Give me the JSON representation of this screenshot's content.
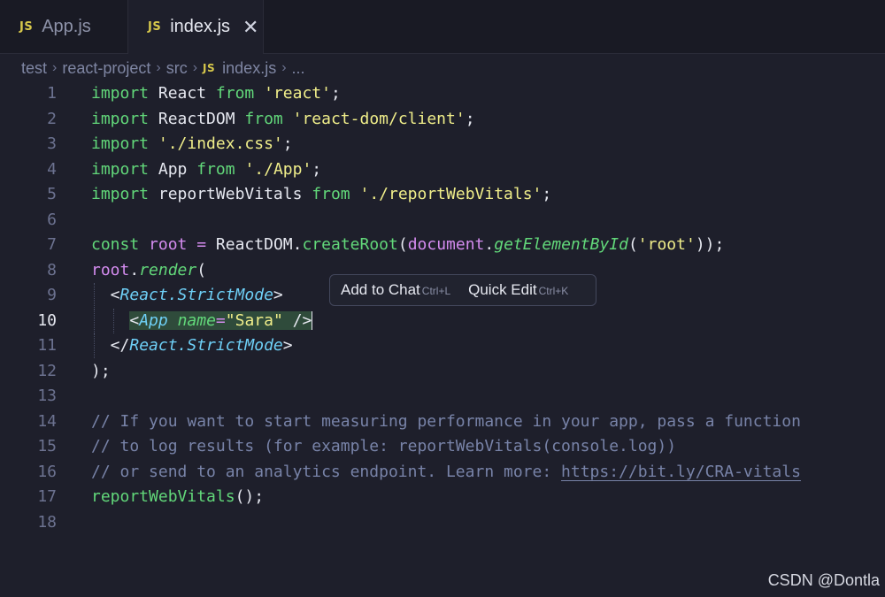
{
  "tabs": [
    {
      "badge": "JS",
      "label": "App.js",
      "active": false
    },
    {
      "badge": "JS",
      "label": "index.js",
      "active": true,
      "close_icon": "close-icon"
    }
  ],
  "breadcrumb": {
    "items": [
      "test",
      "react-project",
      "src"
    ],
    "file_badge": "JS",
    "file": "index.js",
    "more": "..."
  },
  "editor": {
    "active_line": 10,
    "line_numbers": [
      "1",
      "2",
      "3",
      "4",
      "5",
      "6",
      "7",
      "8",
      "9",
      "10",
      "11",
      "12",
      "13",
      "14",
      "15",
      "16",
      "17",
      "18"
    ],
    "tokens": {
      "import": "import",
      "from": "from",
      "react_id": "React",
      "react_str": "'react'",
      "reactdom_id": "ReactDOM",
      "reactdom_str": "'react-dom/client'",
      "css_str": "'./index.css'",
      "app_id": "App",
      "app_str": "'./App'",
      "rwv_id": "reportWebVitals",
      "rwv_str": "'./reportWebVitals'",
      "const": "const",
      "root": "root",
      "eq": "=",
      "createRoot": "createRoot",
      "document": "document",
      "getElementById": "getElementById",
      "root_str": "'root'",
      "render": "render",
      "strict_open": "React.StrictMode",
      "app_tag": "App",
      "name_attr": "name",
      "sara_str": "\"Sara\"",
      "strict_close": "React.StrictMode",
      "comment1": "// If you want to start measuring performance in your app, pass a function",
      "comment2": "// to log results (for example: reportWebVitals(console.log))",
      "comment3_pre": "// or send to an analytics endpoint. Learn more: ",
      "comment3_link": "https://bit.ly/CRA-vitals",
      "rwv_call": "reportWebVitals"
    }
  },
  "popup": {
    "add_to_chat": "Add to Chat",
    "add_to_chat_key": "Ctrl+L",
    "quick_edit": "Quick Edit",
    "quick_edit_key": "Ctrl+K"
  },
  "watermark": "CSDN @Dontla",
  "colors": {
    "background": "#1e1f2b",
    "keyword": "#62d87a",
    "string": "#f0ee8a",
    "jsx_tag": "#6ecff6",
    "variable": "#d58cf0",
    "comment": "#7883a8"
  }
}
